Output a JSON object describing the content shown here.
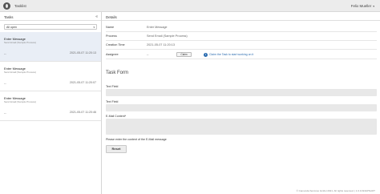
{
  "header": {
    "app_title": "Tasklist",
    "user_name": "Felix Mueller",
    "chevron": "▾"
  },
  "tasks_panel": {
    "title": "Tasks",
    "collapse": "«",
    "filter": {
      "selected": "All open",
      "chevron": "▾"
    },
    "items": [
      {
        "title": "Enter Message",
        "process": "Send Email (Sample Process)",
        "assignee": "--",
        "created": "2021-05-07 11:20:13"
      },
      {
        "title": "Enter Message",
        "process": "Send Email (Sample Process)",
        "assignee": "--",
        "created": "2021-05-07 11:20:07"
      },
      {
        "title": "Enter Message",
        "process": "Send Email (Sample Process)",
        "assignee": "--",
        "created": "2021-05-07 11:20:46"
      }
    ]
  },
  "details": {
    "title": "Details",
    "rows": {
      "name": {
        "label": "Name",
        "value": "Enter Message"
      },
      "process": {
        "label": "Process",
        "value": "Send Email (Sample Process)"
      },
      "creation_time": {
        "label": "Creation Time",
        "value": "2021-05-07 11:20:13"
      },
      "assignee": {
        "label": "Assignee",
        "value": "--",
        "claim_label": "Claim",
        "hint": "Claim the Task to start working on it"
      }
    },
    "info_icon": "i"
  },
  "task_form": {
    "title": "Task Form",
    "fields": [
      {
        "label": "Text Field"
      },
      {
        "label": "Text Field"
      },
      {
        "label": "E-Mail Content*"
      }
    ],
    "help": "Please enter the content of the E-Mail message",
    "reset_label": "Reset"
  },
  "footer": {
    "text": "© Camunda Services GmbH 2021. All rights reserved. | 1.0.0-SNAPSHOT"
  }
}
